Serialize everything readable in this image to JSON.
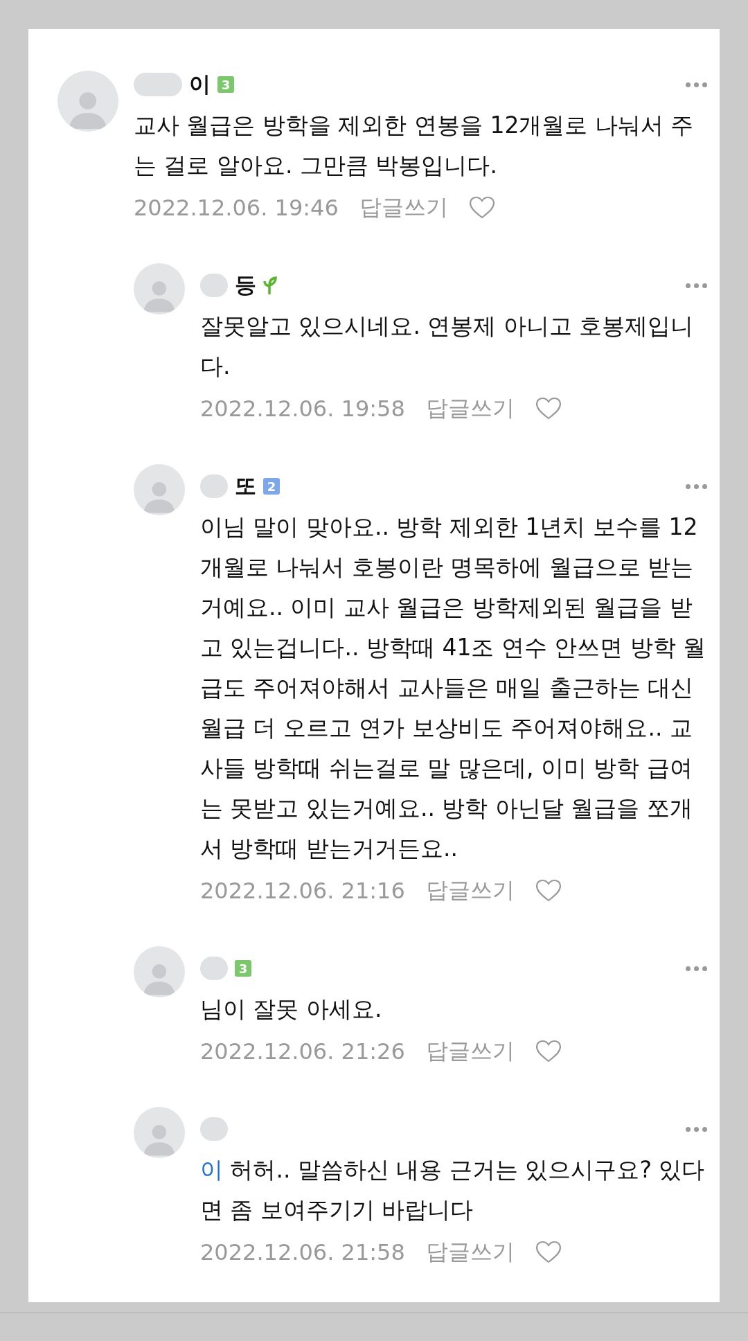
{
  "comments": [
    {
      "reply": false,
      "name": "이",
      "badge": {
        "kind": "level",
        "label": "3",
        "color": "#7cc66b"
      },
      "text": "교사 월급은 방학을 제외한 연봉을 12개월로 나눠서 주는 걸로 알아요. 그만큼 박봉입니다.",
      "time": "2022.12.06. 19:46",
      "reply_label": "답글쓰기",
      "liked": false
    },
    {
      "reply": true,
      "name": "등",
      "badge": {
        "kind": "sprout",
        "color": "#5cb531"
      },
      "text": "잘못알고 있으시네요. 연봉제 아니고 호봉제입니다.",
      "time": "2022.12.06. 19:58",
      "reply_label": "답글쓰기",
      "liked": false
    },
    {
      "reply": true,
      "name": "또",
      "badge": {
        "kind": "level",
        "label": "2",
        "color": "#7ea6ea"
      },
      "text": "이님 말이 맞아요.. 방학 제외한 1년치 보수를 12개월로 나눠서 호봉이란 명목하에 월급으로 받는거예요.. 이미 교사 월급은 방학제외된 월급을 받고 있는겁니다.. 방학때 41조 연수 안쓰면 방학 월급도 주어져야해서 교사들은 매일 출근하는 대신 월급 더 오르고 연가 보상비도 주어져야해요.. 교사들 방학때 쉬는걸로 말 많은데, 이미 방학 급여는 못받고 있는거예요.. 방학 아닌달 월급을 쪼개서 방학때 받는거거든요..",
      "time": "2022.12.06. 21:16",
      "reply_label": "답글쓰기",
      "liked": false
    },
    {
      "reply": true,
      "badge": {
        "kind": "level",
        "label": "3",
        "color": "#7cc66b"
      },
      "text": "님이 잘못 아세요.",
      "time": "2022.12.06. 21:26",
      "reply_label": "답글쓰기",
      "liked": false
    },
    {
      "reply": true,
      "mention": "이",
      "text": " 허허.. 말씀하신 내용 근거는 있으시구요? 있다면 좀 보여주기기 바랍니다",
      "time": "2022.12.06. 21:58",
      "reply_label": "답글쓰기",
      "liked": false
    }
  ]
}
